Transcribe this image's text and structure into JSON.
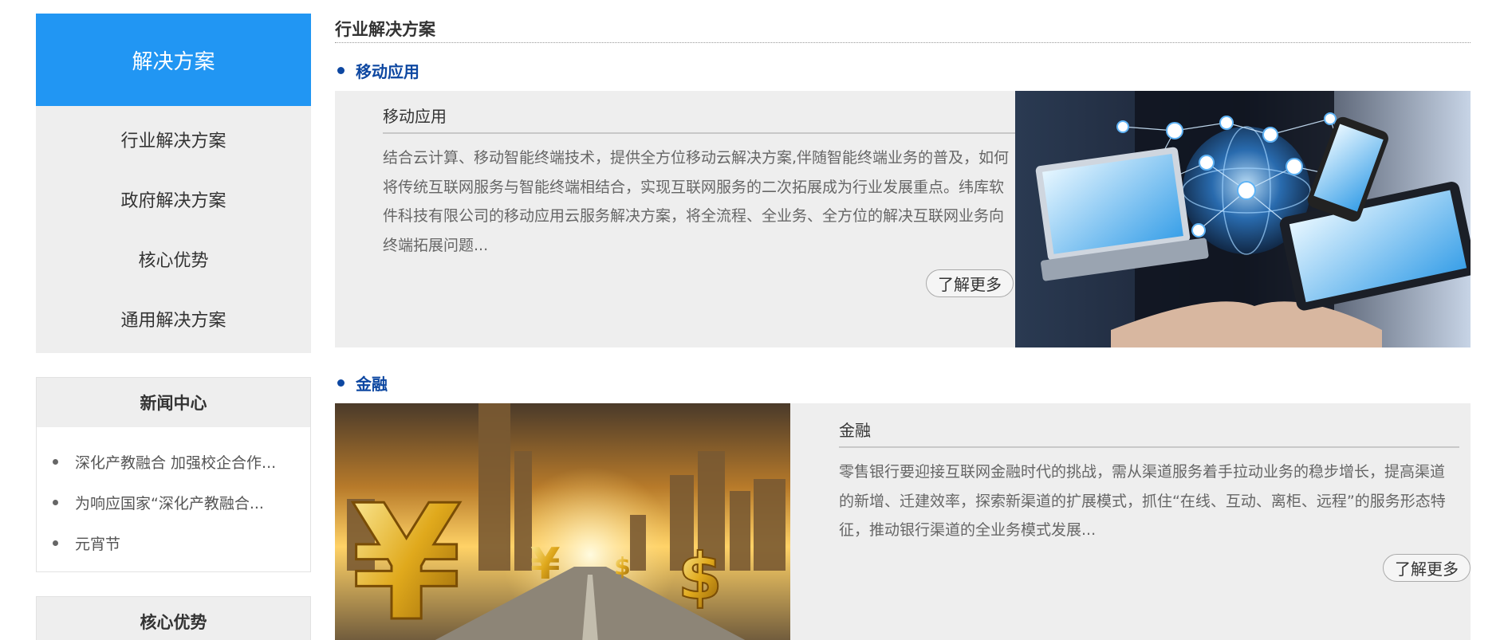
{
  "sidebar": {
    "header": "解决方案",
    "menu": [
      "行业解决方案",
      "政府解决方案",
      "核心优势",
      "通用解决方案"
    ],
    "news": {
      "title": "新闻中心",
      "items": [
        "深化产教融合 加强校企合作...",
        "为响应国家“深化产教融合...",
        "元宵节"
      ]
    },
    "core": {
      "title": "核心优势"
    }
  },
  "main": {
    "title": "行业解决方案",
    "sections": [
      {
        "category": "移动应用",
        "card_title": "移动应用",
        "desc": "结合云计算、移动智能终端技术，提供全方位移动云解决方案,伴随智能终端业务的普及，如何将传统互联网服务与智能终端相结合，实现互联网服务的二次拓展成为行业发展重点。纬库软件科技有限公司的移动应用云服务解决方案，将全流程、全业务、全方位的解决互联网业务向终端拓展问题...",
        "more": "了解更多"
      },
      {
        "category": "金融",
        "card_title": "金融",
        "desc": "零售银行要迎接互联网金融时代的挑战，需从渠道服务着手拉动业务的稳步增长，提高渠道的新增、迁建效率，探索新渠道的扩展模式，抓住“在线、互动、离柜、远程”的服务形态特征，推动银行渠道的全业务模式发展...",
        "more": "了解更多"
      }
    ]
  },
  "colors": {
    "accent": "#2196f3",
    "category": "#0d47a1",
    "panel": "#eeeeee"
  },
  "icons": {
    "bullet": "bullet-dot-icon"
  }
}
